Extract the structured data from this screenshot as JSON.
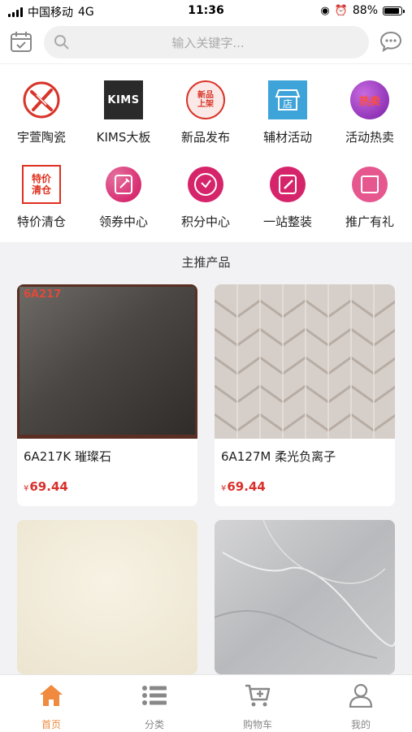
{
  "status": {
    "carrier": "中国移动",
    "network": "4G",
    "time": "11:36",
    "battery": "88%"
  },
  "search": {
    "placeholder": "输入关键字..."
  },
  "categories": [
    {
      "label": "宇萱陶瓷",
      "icon": "yuxuan-logo-icon"
    },
    {
      "label": "KIMS大板",
      "icon": "kims-logo-icon",
      "logo_text": "KIMS"
    },
    {
      "label": "新品发布",
      "icon": "new-product-stamp-icon",
      "stamp_text": "新品上架"
    },
    {
      "label": "辅材活动",
      "icon": "shop-icon"
    },
    {
      "label": "活动热卖",
      "icon": "hot-sale-icon",
      "badge_text": "热卖"
    },
    {
      "label": "特价清仓",
      "icon": "clearance-icon",
      "badge_text": "特价清仓"
    },
    {
      "label": "领券中心",
      "icon": "coupon-icon"
    },
    {
      "label": "积分中心",
      "icon": "points-clock-icon"
    },
    {
      "label": "一站整装",
      "icon": "renovation-icon"
    },
    {
      "label": "推广有礼",
      "icon": "promotion-gift-icon"
    }
  ],
  "section_title": "主推产品",
  "products": [
    {
      "name": "6A217K 璀璨石",
      "currency": "¥",
      "price": "69.44",
      "image_label": "6A217"
    },
    {
      "name": "6A127M 柔光负离子",
      "currency": "¥",
      "price": "69.44",
      "image_label": ""
    },
    {
      "name": "",
      "currency": "",
      "price": "",
      "image_label": ""
    },
    {
      "name": "",
      "currency": "",
      "price": "",
      "image_label": ""
    }
  ],
  "tabs": [
    {
      "label": "首页",
      "icon": "home-icon",
      "active": true
    },
    {
      "label": "分类",
      "icon": "list-icon",
      "active": false
    },
    {
      "label": "购物车",
      "icon": "cart-icon",
      "active": false
    },
    {
      "label": "我的",
      "icon": "user-icon",
      "active": false
    }
  ],
  "colors": {
    "accent": "#f08a3e",
    "price": "#d9302b",
    "pink": "#e03a7a"
  }
}
